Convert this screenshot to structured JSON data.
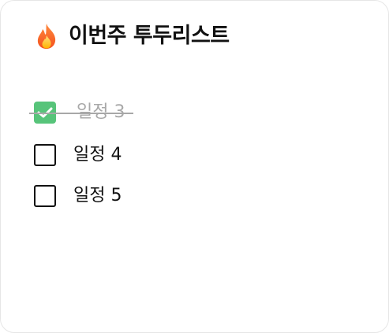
{
  "header": {
    "icon": "fire-icon",
    "title": "이번주 투두리스트"
  },
  "todos": [
    {
      "label": "일정 3",
      "checked": true
    },
    {
      "label": "일정 4",
      "checked": false
    },
    {
      "label": "일정 5",
      "checked": false
    }
  ],
  "colors": {
    "check_fill": "#57c47a",
    "done_text": "#a8a8a8",
    "text": "#111111"
  }
}
